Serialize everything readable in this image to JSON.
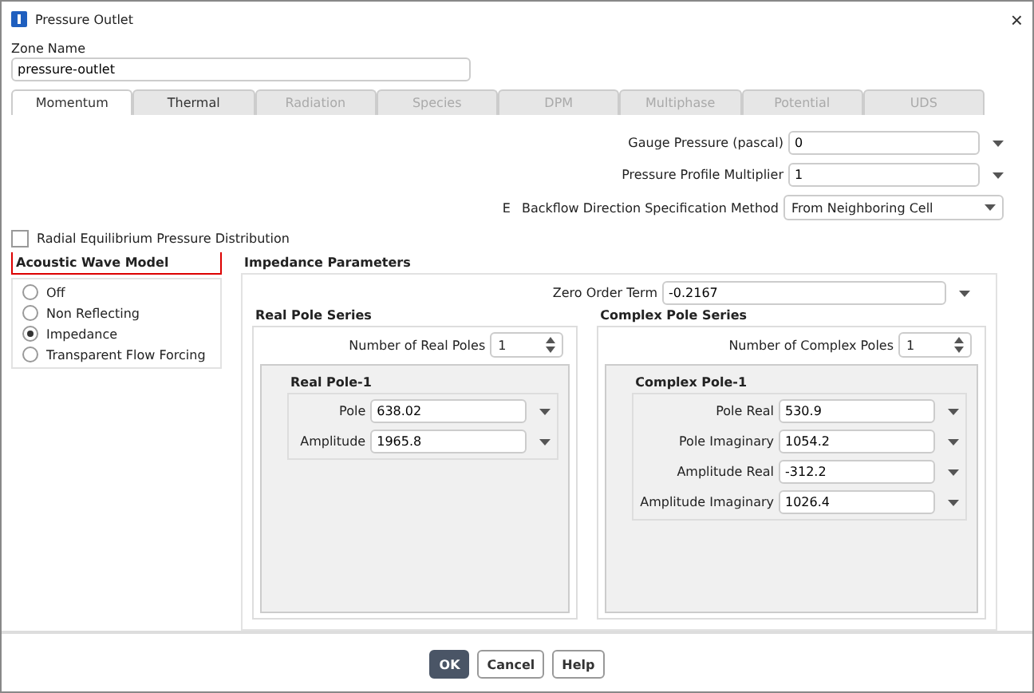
{
  "window": {
    "title": "Pressure Outlet",
    "close": "×"
  },
  "zone": {
    "label": "Zone Name",
    "value": "pressure-outlet"
  },
  "tabs": [
    {
      "label": "Momentum",
      "selected": true,
      "disabled": false
    },
    {
      "label": "Thermal",
      "selected": false,
      "disabled": false
    },
    {
      "label": "Radiation",
      "selected": false,
      "disabled": true
    },
    {
      "label": "Species",
      "selected": false,
      "disabled": true
    },
    {
      "label": "DPM",
      "selected": false,
      "disabled": true
    },
    {
      "label": "Multiphase",
      "selected": false,
      "disabled": true
    },
    {
      "label": "Potential",
      "selected": false,
      "disabled": true
    },
    {
      "label": "UDS",
      "selected": false,
      "disabled": true
    }
  ],
  "momentum": {
    "marker": "E",
    "fields": [
      {
        "kind": "input",
        "label": "Gauge Pressure (pascal)",
        "value": "0"
      },
      {
        "kind": "input",
        "label": "Pressure Profile Multiplier",
        "value": "1"
      },
      {
        "kind": "select",
        "label": "Backflow Direction Specification Method",
        "value": "From Neighboring Cell"
      }
    ]
  },
  "radial": {
    "label": "Radial Equilibrium Pressure Distribution",
    "checked": false
  },
  "acoustic": {
    "title": "Acoustic Wave Model",
    "highlighted": true,
    "options": [
      {
        "label": "Off",
        "selected": false
      },
      {
        "label": "Non Reflecting",
        "selected": false
      },
      {
        "label": "Impedance",
        "selected": true
      },
      {
        "label": "Transparent Flow Forcing",
        "selected": false
      }
    ]
  },
  "impedance": {
    "title": "Impedance Parameters",
    "zero_order": {
      "label": "Zero Order Term",
      "value": "-0.2167"
    },
    "series": [
      {
        "title": "Real Pole Series",
        "count_label": "Number of Real Poles",
        "count": "1",
        "pole_title": "Real Pole-1",
        "fields": [
          {
            "label": "Pole",
            "value": "638.02"
          },
          {
            "label": "Amplitude",
            "value": "1965.8"
          }
        ]
      },
      {
        "title": "Complex Pole Series",
        "count_label": "Number of Complex Poles",
        "count": "1",
        "pole_title": "Complex Pole-1",
        "fields": [
          {
            "label": "Pole Real",
            "value": "530.9"
          },
          {
            "label": "Pole Imaginary",
            "value": "1054.2"
          },
          {
            "label": "Amplitude Real",
            "value": "-312.2"
          },
          {
            "label": "Amplitude Imaginary",
            "value": "1026.4"
          }
        ]
      }
    ]
  },
  "buttons": [
    {
      "label": "OK",
      "default": true
    },
    {
      "label": "Cancel",
      "default": false
    },
    {
      "label": "Help",
      "default": false
    }
  ]
}
